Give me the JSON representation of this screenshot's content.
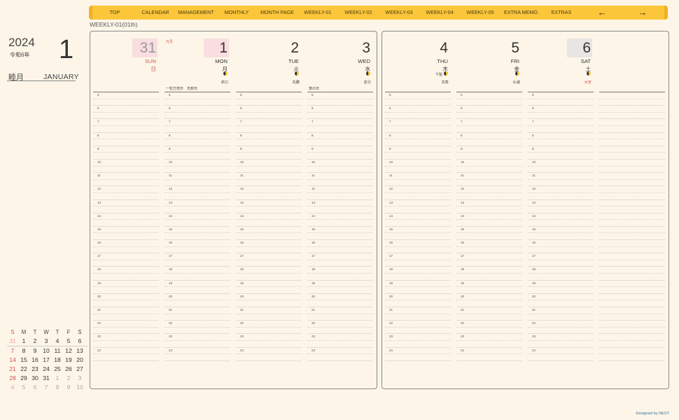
{
  "nav": {
    "items": [
      "TOP",
      "CALENDAR",
      "MANAGEMENT",
      "MONTHLY",
      "MONTH PAGE",
      "WEEKLY-01",
      "WEEKLY-02",
      "WEEKLY-03",
      "WEEKLY-04",
      "WEEKLY-05",
      "EXTRA MEMO",
      "EXTRAS"
    ],
    "prev_arrow": "←",
    "next_arrow": "→"
  },
  "page_label": "WEEKLY-01(01th)",
  "left": {
    "year": "2024",
    "era": "令和6年",
    "month_number": "1",
    "kyureki": "睦月",
    "month_name": "JANUARY"
  },
  "mini_calendar": {
    "headers": [
      "S",
      "M",
      "T",
      "W",
      "T",
      "F",
      "S"
    ],
    "weeks": [
      [
        "31",
        "1",
        "2",
        "3",
        "4",
        "5",
        "6"
      ],
      [
        "7",
        "8",
        "9",
        "10",
        "11",
        "12",
        "13"
      ],
      [
        "14",
        "15",
        "16",
        "17",
        "18",
        "19",
        "20"
      ],
      [
        "21",
        "22",
        "23",
        "24",
        "25",
        "26",
        "27"
      ],
      [
        "28",
        "29",
        "30",
        "31",
        "1",
        "2",
        "3"
      ],
      [
        "4",
        "5",
        "6",
        "7",
        "8",
        "9",
        "10"
      ]
    ]
  },
  "days": [
    {
      "num": "31",
      "eng": "SUN",
      "jp": "日",
      "rokuyo": "",
      "moon": false,
      "note_tl": "",
      "note_bl": ""
    },
    {
      "num": "1",
      "eng": "MON",
      "jp": "月",
      "rokuyo": "赤口",
      "moon": true,
      "note_tl": "元旦",
      "note_bl": "一粒万倍日　天赦日"
    },
    {
      "num": "2",
      "eng": "TUE",
      "jp": "火",
      "rokuyo": "先勝",
      "moon": true,
      "note_tl": "",
      "note_bl": ""
    },
    {
      "num": "3",
      "eng": "WED",
      "jp": "水",
      "rokuyo": "友引",
      "moon": true,
      "note_tl": "",
      "note_bl": "寅の日"
    },
    {
      "num": "4",
      "eng": "THU",
      "jp": "木",
      "rokuyo": "先負",
      "moon": true,
      "moon_label": "下弦",
      "note_tl": "",
      "note_bl": ""
    },
    {
      "num": "5",
      "eng": "FRI",
      "jp": "金",
      "rokuyo": "仏滅",
      "moon": true,
      "note_tl": "",
      "note_bl": ""
    },
    {
      "num": "6",
      "eng": "SAT",
      "jp": "土",
      "rokuyo": "大安",
      "moon": true,
      "note_tl": "",
      "note_bl": ""
    }
  ],
  "hours": [
    "5",
    "6",
    "7",
    "8",
    "9",
    "10",
    "11",
    "12",
    "13",
    "14",
    "15",
    "16",
    "17",
    "18",
    "19",
    "20",
    "21",
    "22",
    "23",
    "24"
  ],
  "credit": "Designed by NEST",
  "colors": {
    "nav": "#fbc63a",
    "accent_red": "#d05050",
    "background": "#fdf6e8"
  }
}
